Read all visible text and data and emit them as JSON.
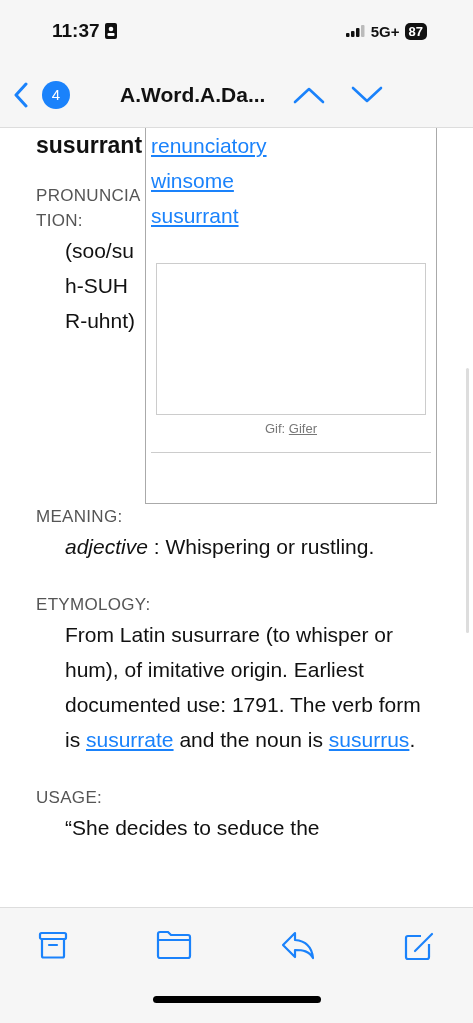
{
  "status_bar": {
    "time": "11:37",
    "network": "5G+",
    "battery": "87"
  },
  "nav": {
    "unread_count": "4",
    "title": "A.Word.A.Da..."
  },
  "entry": {
    "headword": "susurrant",
    "related_links": [
      "renunciatory",
      "winsome",
      "susurrant"
    ],
    "media": {
      "kind": "picture",
      "caption_prefix": "Gif: ",
      "caption_link": "Gifer"
    },
    "sections": [
      {
        "label": "PRONUNCIATION:",
        "kind": "pronunciation",
        "text": "(soo/suh-SUHR-uhnt)"
      },
      {
        "label": "MEANING:",
        "kind": "rich",
        "text": "*adjective* : Whispering or rustling."
      },
      {
        "label": "ETYMOLOGY:",
        "kind": "segments",
        "segments": [
          {
            "text": "From Latin susurrare (to whisper or hum), of imitative origin. Earliest documented use: 1791. The verb form is "
          },
          {
            "link": "susurrate"
          },
          {
            "text": " and the noun is "
          },
          {
            "link": "susurrus"
          },
          {
            "text": "."
          }
        ]
      },
      {
        "label": "USAGE:",
        "kind": "rich",
        "text": "“She decides to seduce the"
      }
    ]
  }
}
